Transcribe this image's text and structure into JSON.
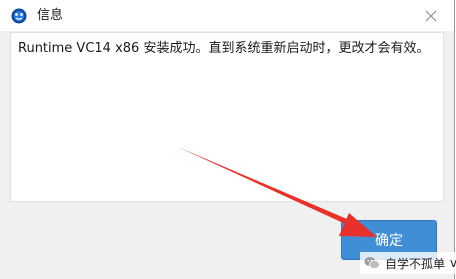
{
  "window": {
    "title": "信息"
  },
  "message": {
    "text": "Runtime VC14 x86 安装成功。直到系统重新启动时，更改才会有效。"
  },
  "buttons": {
    "ok_label": "确定"
  },
  "watermark": {
    "text": "自学不孤单",
    "suffix": "vc"
  },
  "icons": {
    "app": "app-icon",
    "close": "close-icon",
    "arrow": "red-arrow-annotation",
    "watermark": "wechat-icon"
  },
  "colors": {
    "button_blue": "#3f8ed6",
    "arrow_red": "#e8312a"
  }
}
